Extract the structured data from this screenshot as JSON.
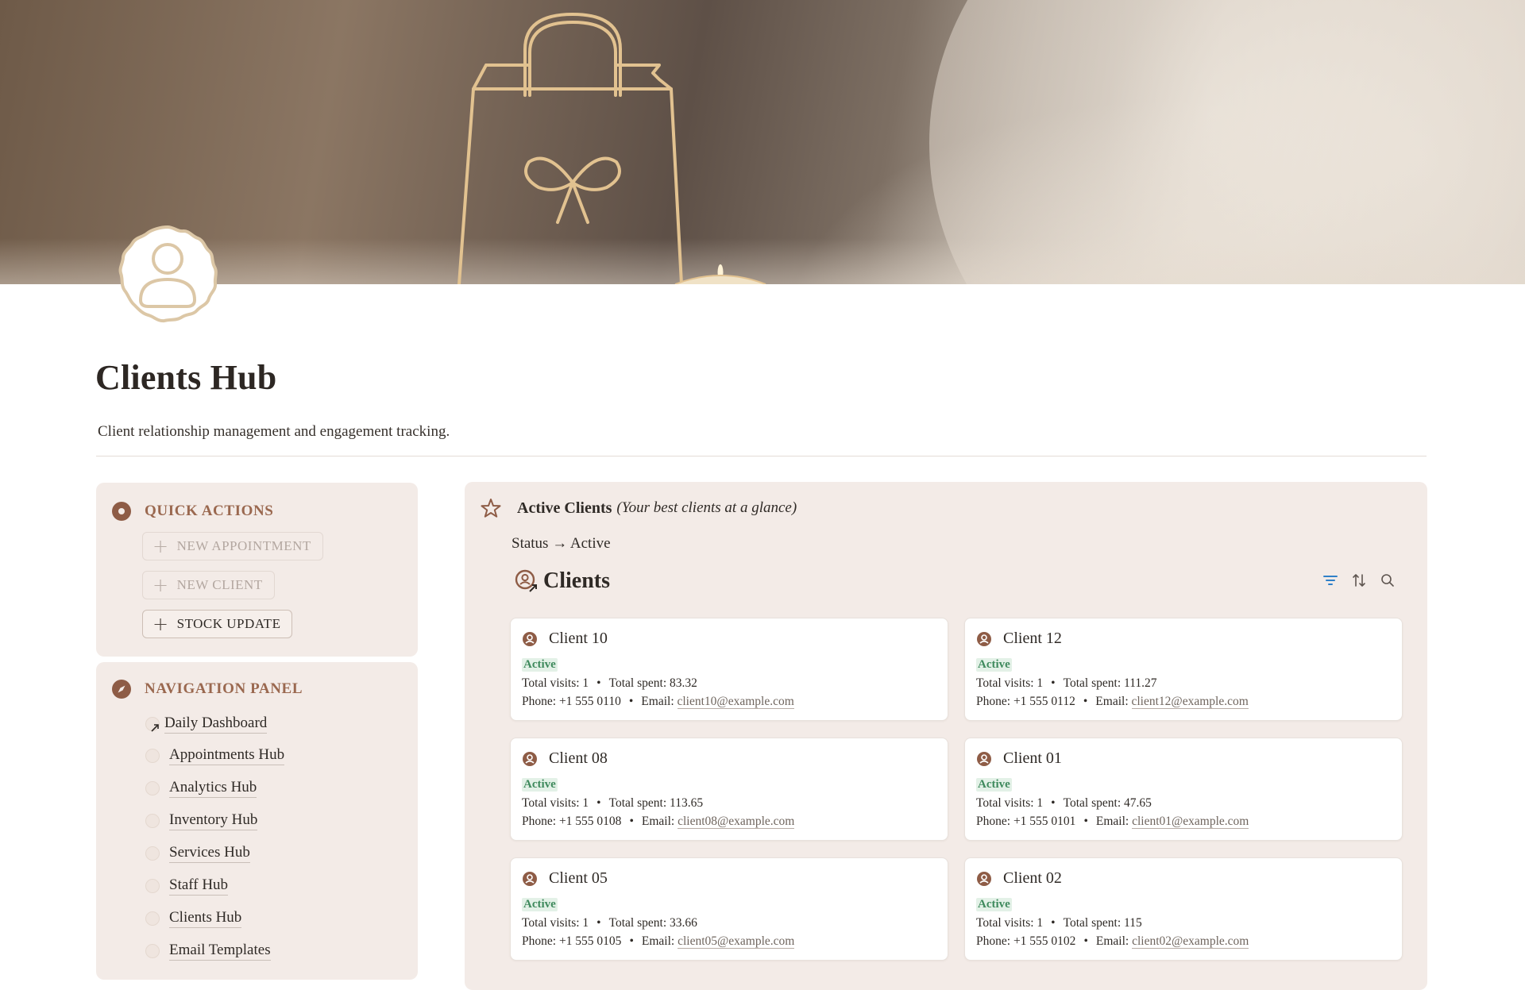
{
  "page": {
    "title": "Clients Hub",
    "subtitle": "Client relationship management and engagement tracking."
  },
  "quick_actions": {
    "heading": "QUICK ACTIONS",
    "buttons": [
      "NEW APPOINTMENT",
      "NEW CLIENT",
      "STOCK UPDATE"
    ]
  },
  "navigation": {
    "heading": "NAVIGATION PANEL",
    "items": [
      "Daily Dashboard",
      "Appointments Hub",
      "Analytics Hub",
      "Inventory Hub",
      "Services Hub",
      "Staff Hub",
      "Clients Hub",
      "Email Templates"
    ]
  },
  "active_clients": {
    "title": "Active Clients",
    "subtitle": "(Your best clients at a glance)",
    "filter": "Status → Active",
    "database_title": "Clients",
    "labels": {
      "visits": "Total visits:",
      "spent": "Total spent:",
      "phone": "Phone:",
      "email": "Email:",
      "separator": "•"
    },
    "cards": [
      {
        "name": "Client 10",
        "status": "Active",
        "visits": "1",
        "spent": "83.32",
        "phone": "+1 555 0110",
        "email": "client10@example.com"
      },
      {
        "name": "Client 12",
        "status": "Active",
        "visits": "1",
        "spent": "111.27",
        "phone": "+1 555 0112",
        "email": "client12@example.com"
      },
      {
        "name": "Client 08",
        "status": "Active",
        "visits": "1",
        "spent": "113.65",
        "phone": "+1 555 0108",
        "email": "client08@example.com"
      },
      {
        "name": "Client 01",
        "status": "Active",
        "visits": "1",
        "spent": "47.65",
        "phone": "+1 555 0101",
        "email": "client01@example.com"
      },
      {
        "name": "Client 05",
        "status": "Active",
        "visits": "1",
        "spent": "33.66",
        "phone": "+1 555 0105",
        "email": "client05@example.com"
      },
      {
        "name": "Client 02",
        "status": "Active",
        "visits": "1",
        "spent": "115",
        "phone": "+1 555 0102",
        "email": "client02@example.com"
      }
    ]
  },
  "colors": {
    "accent_brown": "#8e5c46",
    "heading_brown": "#9a684f",
    "panel_bg": "#f3ebe7",
    "status_green": "#3f8a5d",
    "status_green_bg": "#e3f1e7",
    "tool_blue": "#2f80c8"
  },
  "icons": {
    "page_icon": "user-badge-icon",
    "quick_actions": "record-dot-icon",
    "navigation": "compass-icon",
    "active_clients": "star-icon",
    "database": "user-link-icon",
    "card": "user-circle-icon",
    "tools": [
      "filter-icon",
      "sort-icon",
      "search-icon"
    ]
  }
}
